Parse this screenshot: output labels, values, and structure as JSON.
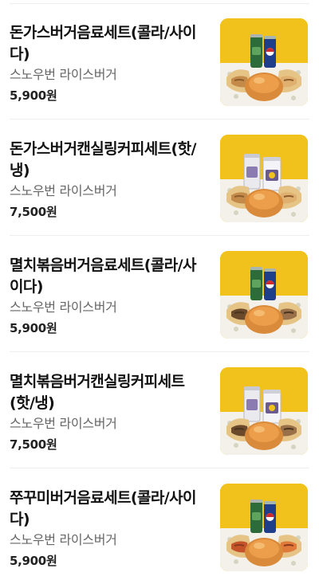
{
  "menu": {
    "items": [
      {
        "name": "돈가스버거음료세트(콜라/사이다)",
        "store": "스노우번 라이스버거",
        "price": "5,900원",
        "variant": "soda",
        "filling": "cutlet"
      },
      {
        "name": "돈가스버거캔실링커피세트(핫/냉)",
        "store": "스노우번 라이스버거",
        "price": "7,500원",
        "variant": "coffee",
        "filling": "cutlet"
      },
      {
        "name": "멸치볶음버거음료세트(콜라/사이다)",
        "store": "스노우번 라이스버거",
        "price": "5,900원",
        "variant": "soda",
        "filling": "anchovy"
      },
      {
        "name": "멸치볶음버거캔실링커피세트(핫/냉)",
        "store": "스노우번 라이스버거",
        "price": "7,500원",
        "variant": "coffee",
        "filling": "anchovy"
      },
      {
        "name": "쭈꾸미버거음료세트(콜라/사이다)",
        "store": "스노우번 라이스버거",
        "price": "5,900원",
        "variant": "soda",
        "filling": "webfoot"
      }
    ]
  },
  "colors": {
    "background": "#ffffff",
    "title": "#111111",
    "store": "#666666",
    "price": "#222222",
    "divider": "#eeeeee",
    "photo_backdrop": "#f2c21c"
  }
}
